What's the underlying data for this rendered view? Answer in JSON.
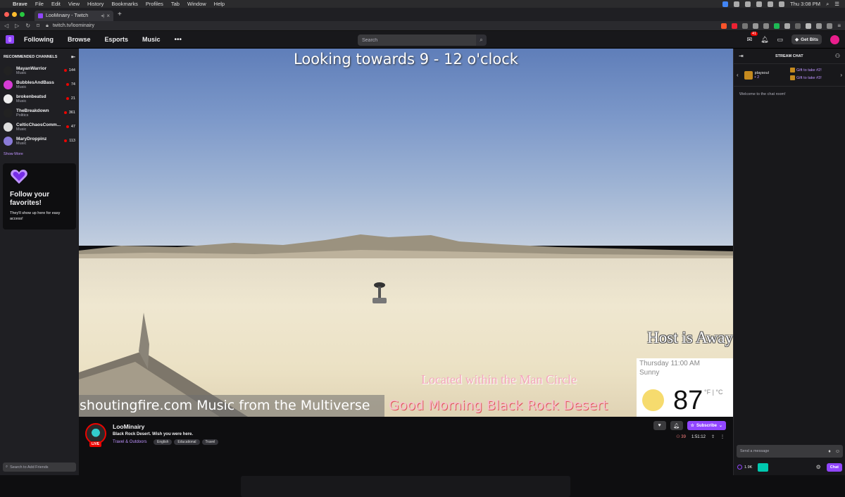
{
  "macos": {
    "app_name": "Brave",
    "menus": [
      "File",
      "Edit",
      "View",
      "History",
      "Bookmarks",
      "Profiles",
      "Tab",
      "Window",
      "Help"
    ],
    "clock": "Thu 3:08 PM"
  },
  "browser": {
    "tab_title": "LooMinairy - Twitch",
    "tab_audio_icon": "speaker-icon",
    "url": "twitch.tv/loominairy",
    "ext_badge_1": "20",
    "colors": {
      "traffic_close": "#ff5f57",
      "traffic_min": "#febc2e",
      "traffic_max": "#28c840"
    }
  },
  "twitch_nav": {
    "following": "Following",
    "browse": "Browse",
    "esports": "Esports",
    "music": "Music",
    "more": "•••",
    "search_placeholder": "Search",
    "inbox_badge": "41",
    "get_bits": "Get Bits"
  },
  "sidebar": {
    "header": "RECOMMENDED CHANNELS",
    "channels": [
      {
        "name": "MayanWarrior",
        "category": "Music",
        "viewers": "144",
        "color": "#222222"
      },
      {
        "name": "BubblesAndBass",
        "category": "Music",
        "viewers": "74",
        "color": "#d63bd6"
      },
      {
        "name": "brokenbeatsd",
        "category": "Music",
        "viewers": "21",
        "color": "#eeeeee"
      },
      {
        "name": "TheBreakdown",
        "category": "Politics",
        "viewers": "361",
        "color": "#222222"
      },
      {
        "name": "CelticChaosComm...",
        "category": "Music",
        "viewers": "47",
        "color": "#dddddd"
      },
      {
        "name": "MaryDroppinz",
        "category": "Music",
        "viewers": "113",
        "color": "#8a7bd8"
      }
    ],
    "show_more": "Show More",
    "follow_title": "Follow your favorites!",
    "follow_sub": "They'll show up here for easy access!",
    "add_friends": "Search to Add Friends"
  },
  "video": {
    "overlay_title": "Looking towards 9 - 12 o'clock",
    "host_away": "Host is Away",
    "man_circle": "Located within the Man Circle",
    "ticker_left": "shoutingfire.com Music from the Multiverse",
    "ticker_right": "Good Morning Black Rock Desert",
    "weather_day": "Thursday 11:00 AM",
    "weather_cond": "Sunny",
    "weather_temp": "87",
    "weather_units": "°F | °C"
  },
  "stream": {
    "streamer": "LooMinairy",
    "live": "LIVE",
    "title": "Black Rock Desert. Wish you were here.",
    "category": "Travel & Outdoors",
    "tags": [
      "English",
      "Educational",
      "Travel"
    ],
    "subscribe": "Subscribe",
    "viewers": "39",
    "uptime": "1:51:12"
  },
  "chat": {
    "header": "STREAM CHAT",
    "gifter": "playsoul",
    "gift_count": "2",
    "gift_2": "Gift to take #2!",
    "gift_3": "Gift to take #3!",
    "welcome": "Welcome to the chat room!",
    "input_placeholder": "Send a message",
    "points": "1.9K",
    "chat_button": "Chat"
  }
}
